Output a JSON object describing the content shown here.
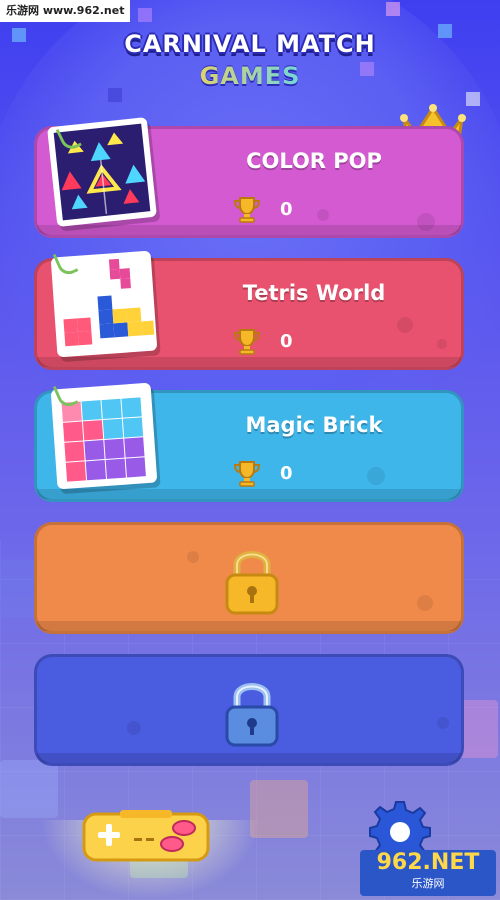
{
  "watermark": {
    "top_left": "乐游网 www.962.net",
    "logo_text": "962.NET",
    "logo_sub": "乐游网"
  },
  "header": {
    "title": "CARNIVAL MATCH",
    "subtitle": "GAMES"
  },
  "games": [
    {
      "name": "COLOR POP",
      "score": "0",
      "color": "#d45ad2",
      "locked": false
    },
    {
      "name": "Tetris World",
      "score": "0",
      "color": "#e8526e",
      "locked": false
    },
    {
      "name": "Magic Brick",
      "score": "0",
      "color": "#3eb6ea",
      "locked": false
    },
    {
      "name": "",
      "score": "",
      "color": "#f08a4a",
      "locked": true
    },
    {
      "name": "",
      "score": "",
      "color": "#4a5ce0",
      "locked": true
    }
  ],
  "icons": {
    "crown": "crown-icon",
    "trophy": "trophy-icon",
    "lock": "padlock-icon",
    "gamepad": "gamepad-icon",
    "settings": "gear-icon"
  },
  "colors": {
    "background": "#4b48ee",
    "gold": "#f6b828",
    "lock_blue": "#5a8de0"
  }
}
